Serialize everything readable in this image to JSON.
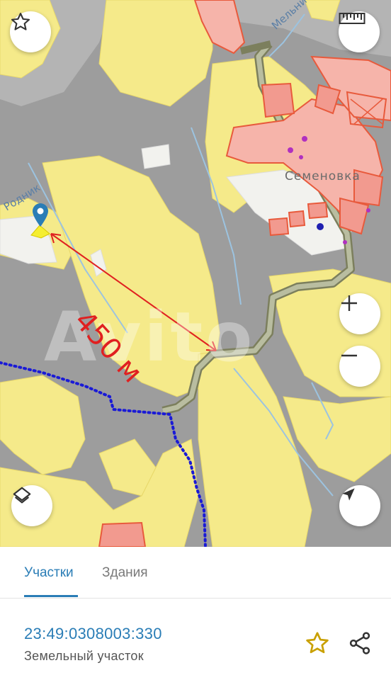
{
  "map": {
    "river_label": "Мельничн...",
    "spring_label": "Родник",
    "village_label": "Семеновка",
    "watermark": "Avito",
    "distance_annotation": "450 м",
    "colors": {
      "parcel_yellow": "#f5ea8a",
      "building_red": "#f29a8f",
      "terrain_gray": "#9a9a9a",
      "route_blue": "#1a1ad6",
      "annotation_red": "#e02020",
      "road_olive": "#8a8e6a",
      "water_blue": "#9cc3e0"
    }
  },
  "controls": {
    "favorite_icon": "star-outline-icon",
    "ruler_icon": "ruler-icon",
    "zoom_in_icon": "plus-icon",
    "zoom_out_icon": "minus-icon",
    "layers_icon": "layers-icon",
    "locate_icon": "navigation-arrow-icon"
  },
  "sheet": {
    "tabs": [
      {
        "label": "Участки",
        "active": true
      },
      {
        "label": "Здания",
        "active": false
      }
    ],
    "parcel": {
      "cadastral_number": "23:49:0308003:330",
      "type": "Земельный участок"
    },
    "favorite_icon": "star-outline-icon",
    "share_icon": "share-icon",
    "accent_color": "#2a7db6",
    "star_color": "#c9a000"
  }
}
